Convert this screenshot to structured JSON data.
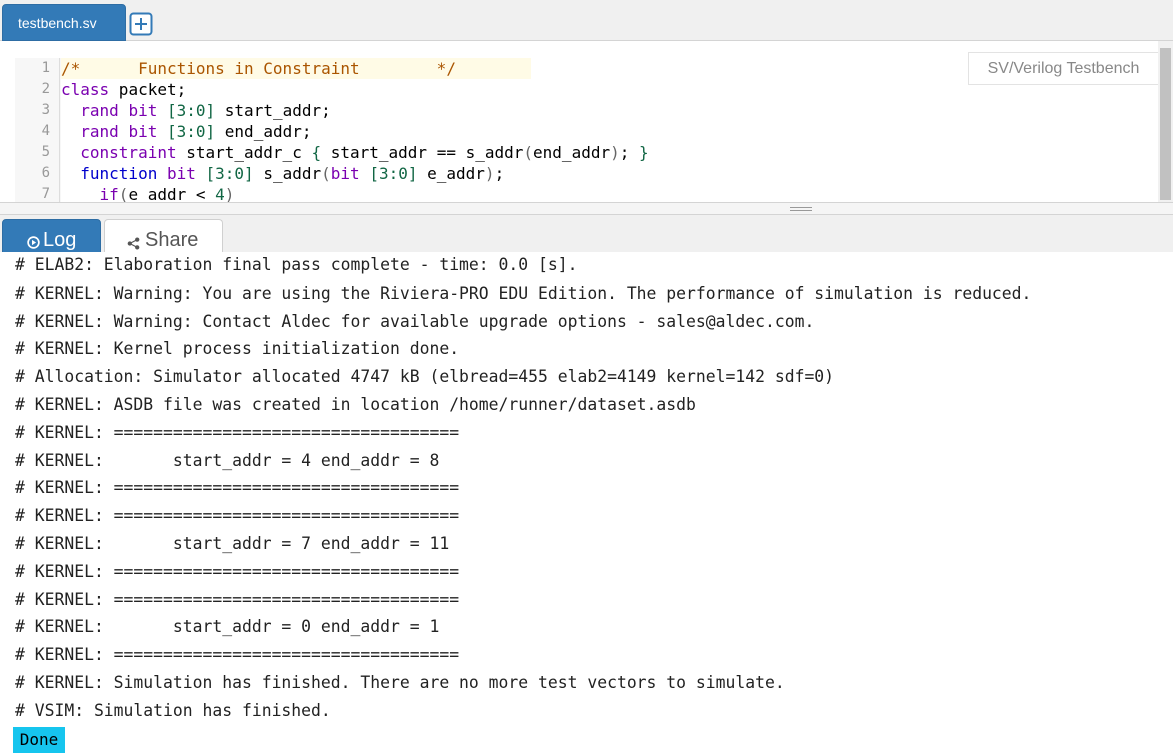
{
  "file_tab": {
    "label": "testbench.sv"
  },
  "add_tab_icon": "plus-square-icon",
  "badge": {
    "label": "SV/Verilog Testbench"
  },
  "editor": {
    "line_numbers": [
      "1",
      "2",
      "3",
      "4",
      "5",
      "6",
      "7"
    ],
    "lines": [
      [
        {
          "t": "/*      Functions in Constraint        */",
          "c": "tok-comment"
        }
      ],
      [
        {
          "t": "class",
          "c": "tok-kw"
        },
        {
          "t": " packet;",
          "c": ""
        }
      ],
      [
        {
          "t": "  ",
          "c": ""
        },
        {
          "t": "rand",
          "c": "tok-kw"
        },
        {
          "t": " ",
          "c": ""
        },
        {
          "t": "bit",
          "c": "tok-kw"
        },
        {
          "t": " ",
          "c": ""
        },
        {
          "t": "[3:0]",
          "c": "tok-num"
        },
        {
          "t": " start_addr;",
          "c": ""
        }
      ],
      [
        {
          "t": "  ",
          "c": ""
        },
        {
          "t": "rand",
          "c": "tok-kw"
        },
        {
          "t": " ",
          "c": ""
        },
        {
          "t": "bit",
          "c": "tok-kw"
        },
        {
          "t": " ",
          "c": ""
        },
        {
          "t": "[3:0]",
          "c": "tok-num"
        },
        {
          "t": " end_addr;",
          "c": ""
        }
      ],
      [
        {
          "t": "  ",
          "c": ""
        },
        {
          "t": "constraint",
          "c": "tok-kw"
        },
        {
          "t": " start_addr_c ",
          "c": ""
        },
        {
          "t": "{",
          "c": "tok-num"
        },
        {
          "t": " start_addr == s_addr",
          "c": ""
        },
        {
          "t": "(",
          "c": "tok-punct"
        },
        {
          "t": "end_addr",
          "c": ""
        },
        {
          "t": ")",
          "c": "tok-punct"
        },
        {
          "t": "; ",
          "c": ""
        },
        {
          "t": "}",
          "c": "tok-num"
        }
      ],
      [
        {
          "t": "  ",
          "c": ""
        },
        {
          "t": "function",
          "c": "tok-kw2"
        },
        {
          "t": " ",
          "c": ""
        },
        {
          "t": "bit",
          "c": "tok-kw"
        },
        {
          "t": " ",
          "c": ""
        },
        {
          "t": "[3:0]",
          "c": "tok-num"
        },
        {
          "t": " s_addr",
          "c": ""
        },
        {
          "t": "(",
          "c": "tok-punct"
        },
        {
          "t": "bit",
          "c": "tok-kw"
        },
        {
          "t": " ",
          "c": ""
        },
        {
          "t": "[3:0]",
          "c": "tok-num"
        },
        {
          "t": " e_addr",
          "c": ""
        },
        {
          "t": ")",
          "c": "tok-punct"
        },
        {
          "t": ";",
          "c": ""
        }
      ],
      [
        {
          "t": "    ",
          "c": ""
        },
        {
          "t": "if",
          "c": "tok-kw"
        },
        {
          "t": "(",
          "c": "tok-punct"
        },
        {
          "t": "e_addr < ",
          "c": ""
        },
        {
          "t": "4",
          "c": "tok-num"
        },
        {
          "t": ")",
          "c": "tok-punct"
        }
      ]
    ]
  },
  "tabs": {
    "log": {
      "label": "Log",
      "icon": "play-circle-icon"
    },
    "share": {
      "label": "Share",
      "icon": "share-icon"
    }
  },
  "log": {
    "lines": [
      "# ELAB2: Elaboration final pass complete - time: 0.0 [s].",
      "# KERNEL: Warning: You are using the Riviera-PRO EDU Edition. The performance of simulation is reduced.",
      "# KERNEL: Warning: Contact Aldec for available upgrade options - sales@aldec.com.",
      "# KERNEL: Kernel process initialization done.",
      "# Allocation: Simulator allocated 4747 kB (elbread=455 elab2=4149 kernel=142 sdf=0)",
      "# KERNEL: ASDB file was created in location /home/runner/dataset.asdb",
      "# KERNEL: ===================================",
      "# KERNEL:       start_addr = 4 end_addr = 8",
      "# KERNEL: ===================================",
      "# KERNEL: ===================================",
      "# KERNEL:       start_addr = 7 end_addr = 11",
      "# KERNEL: ===================================",
      "# KERNEL: ===================================",
      "# KERNEL:       start_addr = 0 end_addr = 1",
      "# KERNEL: ===================================",
      "# KERNEL: Simulation has finished. There are no more test vectors to simulate.",
      "# VSIM: Simulation has finished."
    ],
    "done_label": "Done"
  },
  "colors": {
    "accent": "#337ab7",
    "done_badge": "#16c5ee"
  }
}
